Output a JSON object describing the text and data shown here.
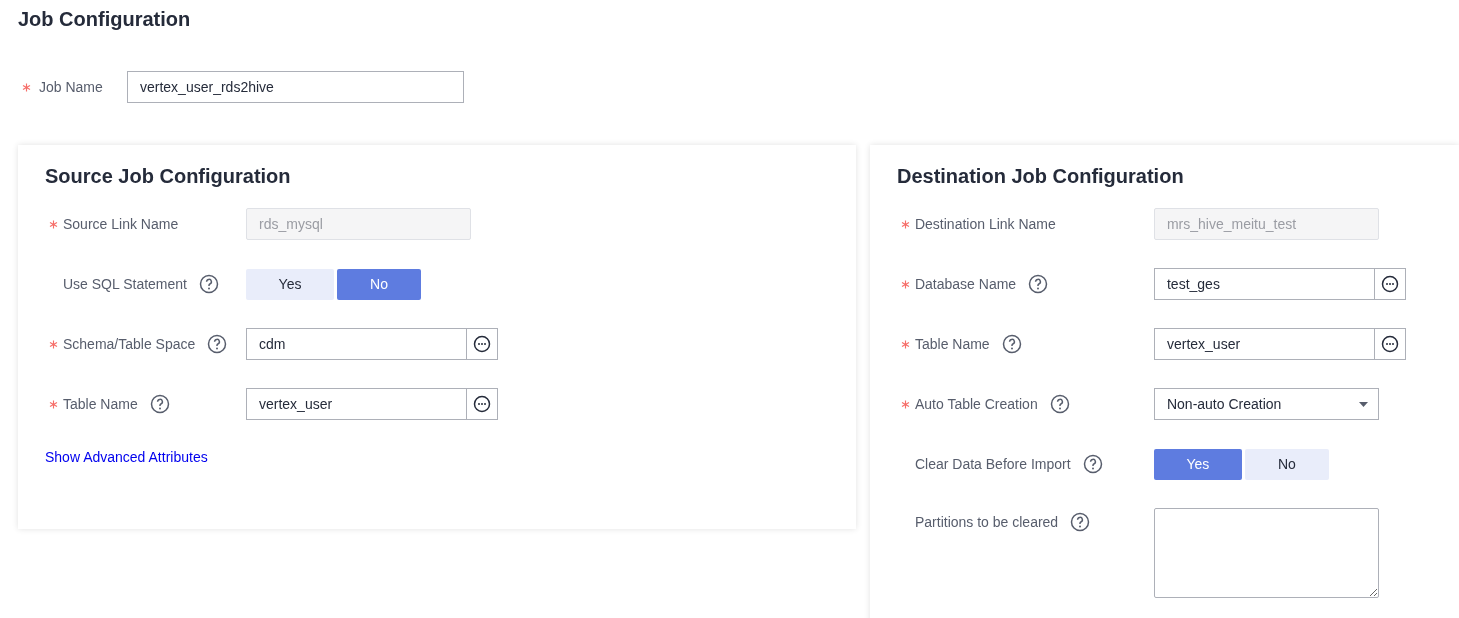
{
  "title": "Job Configuration",
  "job_name": {
    "label": "Job Name",
    "required": true,
    "value": "vertex_user_rds2hive"
  },
  "panels": [
    {
      "title": "Source Job Configuration",
      "fields": [
        {
          "kind": "readonly",
          "label": "Source Link Name",
          "required": true,
          "help": false,
          "disabled": true,
          "value": "rds_mysql"
        },
        {
          "kind": "toggle",
          "label": "Use SQL Statement",
          "required": false,
          "help": true,
          "options": [
            {
              "label": "Yes",
              "selected": false
            },
            {
              "label": "No",
              "selected": true
            }
          ]
        },
        {
          "kind": "picker",
          "label": "Schema/Table Space",
          "required": true,
          "help": true,
          "value": "cdm"
        },
        {
          "kind": "picker",
          "label": "Table Name",
          "required": true,
          "help": true,
          "value": "vertex_user"
        }
      ],
      "link": "Show Advanced Attributes"
    },
    {
      "title": "Destination Job Configuration",
      "fields": [
        {
          "kind": "readonly",
          "label": "Destination Link Name",
          "required": true,
          "help": false,
          "disabled": true,
          "value": "mrs_hive_meitu_test"
        },
        {
          "kind": "picker",
          "label": "Database Name",
          "required": true,
          "help": true,
          "value": "test_ges"
        },
        {
          "kind": "picker",
          "label": "Table Name",
          "required": true,
          "help": true,
          "value": "vertex_user"
        },
        {
          "kind": "select",
          "label": "Auto Table Creation",
          "required": true,
          "help": true,
          "value": "Non-auto Creation"
        },
        {
          "kind": "toggle",
          "label": "Clear Data Before Import",
          "required": false,
          "help": true,
          "options": [
            {
              "label": "Yes",
              "selected": true
            },
            {
              "label": "No",
              "selected": false
            }
          ]
        },
        {
          "kind": "textarea",
          "label": "Partitions to be cleared",
          "required": false,
          "help": true
        }
      ]
    }
  ]
}
